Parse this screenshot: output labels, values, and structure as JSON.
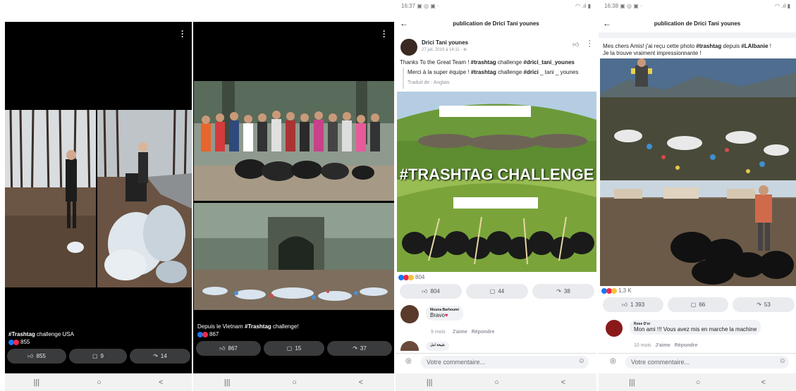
{
  "panel1": {
    "caption_bold": "#Trashtag",
    "caption_rest": " challenge USA",
    "reaction_count": "855",
    "like_count": "855",
    "comment_count": "9",
    "share_count": "14"
  },
  "panel2": {
    "caption_pre": "Depuis le Vietnam ",
    "caption_bold": "#Trashtag",
    "caption_post": " challenge!",
    "reaction_count": "867",
    "like_count": "867",
    "comment_count": "15",
    "share_count": "37"
  },
  "panel3": {
    "status_time": "16:37",
    "header_title": "publication de Drici Tani younes",
    "author": "Drici Tani younes",
    "post_meta": "27 juil. 2019 à 14:11 · ",
    "post_text_pre": "Thanks To the Great Team ! ",
    "post_text_tag1": "#trashtag",
    "post_text_mid": " challenge ",
    "post_text_tag2": "#drici_tani_younes",
    "translation_pre": "Merci à la super équipe ! ",
    "translation_tag1": "#trashtag",
    "translation_mid": " challenge ",
    "translation_tag2": "#drici",
    "translation_post": " _ tani _ younes",
    "translated_from": "Traduit de : Anglais",
    "image_overlay": "#TRASHTAG CHALLENGE",
    "reaction_count": "804",
    "like_count": "804",
    "comment_count": "44",
    "share_count": "38",
    "comment1_name": "Mouna Barhoumi",
    "comment1_text": "Bravo",
    "comment1_time": "9 mois",
    "comment1_like": "J'aime",
    "comment1_reply": "Répondre",
    "comment2_name": "شيخة امل",
    "composer_placeholder": "Votre commentaire..."
  },
  "panel4": {
    "status_time": "16:38",
    "header_title": "publication de Drici Tani younes",
    "post_text_1": "Mes chers Amis! j'ai reçu cette photo ",
    "post_tag1": "#trashtag",
    "post_text_2": " depuis ",
    "post_tag2": "#LAlbanie",
    "post_text_3": " !",
    "post_text_line2": "Je la trouve vraiment impressionnante !",
    "reaction_count": "1,3 K",
    "like_count": "1 393",
    "comment_count": "66",
    "share_count": "53",
    "comment1_name": "Rose D'or",
    "comment1_text": "Mon ami !!! Vous avez mis en marche la machine",
    "comment1_time": "10 mois",
    "comment1_like": "J'aime",
    "comment1_reply": "Répondre",
    "composer_placeholder": "Votre commentaire..."
  },
  "nav": {
    "recent": "|||",
    "home": "○",
    "back": "<"
  },
  "colors": {
    "facebook_blue": "#1877f2",
    "love_red": "#f0284a",
    "dark_bg": "#000000",
    "pill_dark": "#3a3b3c",
    "pill_light": "#e9ebee"
  }
}
